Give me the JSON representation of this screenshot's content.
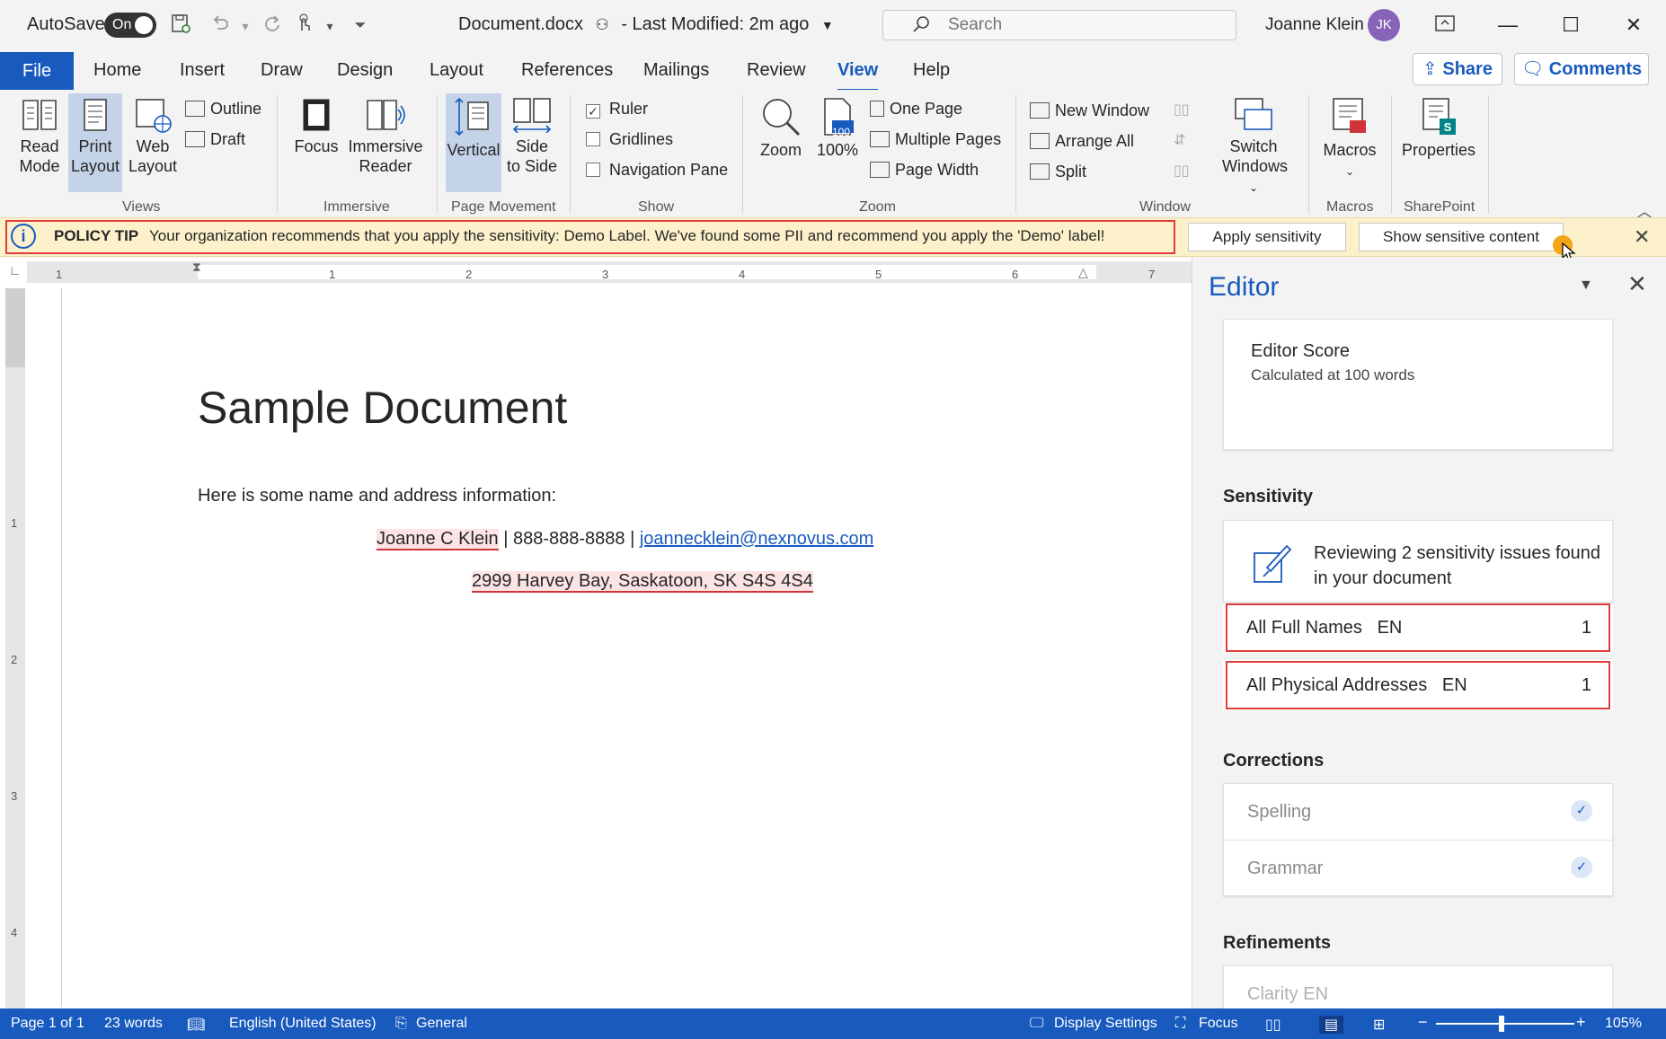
{
  "titlebar": {
    "autosave_label": "AutoSave",
    "autosave_state": "On",
    "document_title": "Document.docx",
    "last_modified": "-  Last Modified: 2m ago",
    "search_placeholder": "Search",
    "user_name": "Joanne Klein",
    "user_initials": "JK"
  },
  "tabs": [
    "File",
    "Home",
    "Insert",
    "Draw",
    "Design",
    "Layout",
    "References",
    "Mailings",
    "Review",
    "View",
    "Help"
  ],
  "active_tab": "View",
  "share_label": "Share",
  "comments_label": "Comments",
  "ribbon": {
    "views": {
      "read_mode": [
        "Read",
        "Mode"
      ],
      "print_layout": [
        "Print",
        "Layout"
      ],
      "web_layout": [
        "Web",
        "Layout"
      ],
      "outline": "Outline",
      "draft": "Draft",
      "label": "Views"
    },
    "immersive": {
      "focus": "Focus",
      "reader": [
        "Immersive",
        "Reader"
      ],
      "label": "Immersive"
    },
    "page_movement": {
      "vertical": "Vertical",
      "side": [
        "Side",
        "to Side"
      ],
      "label": "Page Movement"
    },
    "show": {
      "ruler": "Ruler",
      "gridlines": "Gridlines",
      "navigation": "Navigation Pane",
      "label": "Show"
    },
    "zoom": {
      "zoom": "Zoom",
      "percent": "100%",
      "one_page": "One Page",
      "multiple_pages": "Multiple Pages",
      "page_width": "Page Width",
      "label": "Zoom",
      "icon_badge": "100"
    },
    "window": {
      "new_window": "New Window",
      "arrange_all": "Arrange All",
      "split": "Split",
      "switch": [
        "Switch",
        "Windows"
      ],
      "label": "Window"
    },
    "macros": {
      "macros": "Macros",
      "label": "Macros"
    },
    "sharepoint": {
      "properties": "Properties",
      "label": "SharePoint"
    }
  },
  "policy": {
    "title": "POLICY TIP",
    "text": "Your organization recommends that you apply the sensitivity: Demo Label. We've found some PII and recommend you apply the 'Demo' label!",
    "apply_label": "Apply sensitivity",
    "show_label": "Show sensitive content"
  },
  "ruler": {
    "h_numbers": [
      "1",
      "1",
      "2",
      "3",
      "4",
      "5",
      "6",
      "7"
    ],
    "v_numbers": [
      "1",
      "2",
      "3",
      "4"
    ]
  },
  "document": {
    "heading": "Sample Document",
    "intro": "Here is some name and address information:",
    "name": "Joanne C Klein",
    "separator": " | ",
    "phone": "888-888-8888",
    "email": "joannecklein@nexnovus.com",
    "address": "2999 Harvey Bay, Saskatoon, SK S4S 4S4"
  },
  "editor": {
    "title": "Editor",
    "score_title": "Editor Score",
    "score_sub": "Calculated at 100 words",
    "sensitivity_heading": "Sensitivity",
    "review_text": "Reviewing 2 sensitivity issues found in your document",
    "issues": [
      {
        "label": "All Full Names",
        "lang": "EN",
        "count": "1"
      },
      {
        "label": "All Physical Addresses",
        "lang": "EN",
        "count": "1"
      }
    ],
    "corrections_heading": "Corrections",
    "corrections": [
      "Spelling",
      "Grammar"
    ],
    "refinements_heading": "Refinements",
    "refinement_partial": "Clarity  EN"
  },
  "status": {
    "page": "Page 1 of 1",
    "words": "23 words",
    "language": "English (United States)",
    "label": "General",
    "display_settings": "Display Settings",
    "focus": "Focus",
    "zoom_minus": "−",
    "zoom_plus": "+",
    "zoom": "105%"
  },
  "colors": {
    "accent": "#185abd",
    "highlight_frame": "#e03c3c",
    "policy_bg": "#fcf1cb"
  },
  "icons": [
    "search-icon",
    "info-icon",
    "close-icon",
    "sensitivity-icon",
    "check-icon",
    "chevron-down-icon"
  ]
}
